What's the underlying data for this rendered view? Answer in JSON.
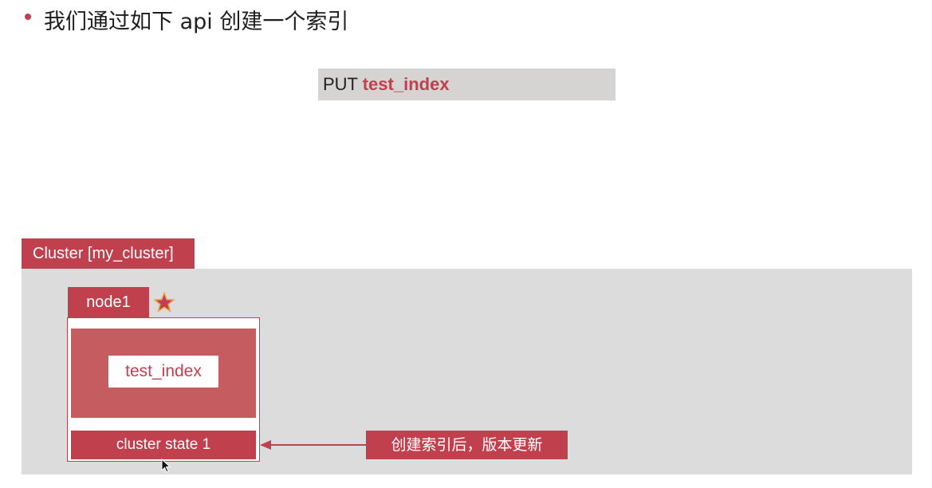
{
  "slide": {
    "bullet_text": "我们通过如下 api 创建一个索引"
  },
  "api": {
    "method": "PUT",
    "index_name": "test_index"
  },
  "cluster": {
    "label": "Cluster [my_cluster]",
    "node": {
      "label": "node1",
      "master_icon": "star-icon",
      "index_label": "test_index",
      "state_label": "cluster state 1"
    },
    "callout_text": "创建索引后，版本更新"
  },
  "colors": {
    "accent": "#c0404e",
    "index_panel": "#c55c60",
    "cluster_bg": "#dcdcdc",
    "code_bg": "#d6d4d2",
    "star": "#c0404e",
    "star_outline": "#e8b04a"
  }
}
